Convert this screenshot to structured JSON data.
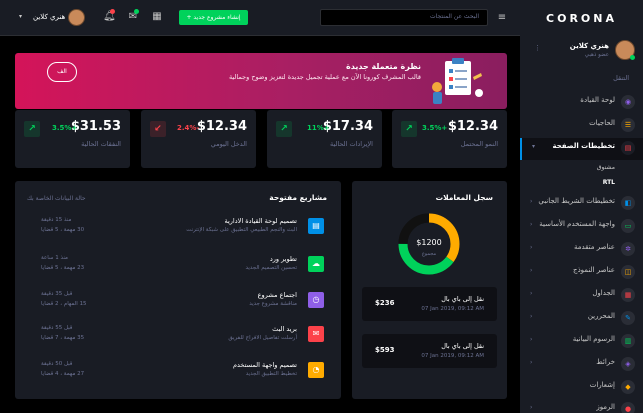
{
  "colors": {
    "bg": "#000000",
    "card": "#191c24",
    "success": "#00d25b",
    "danger": "#fc424a",
    "info": "#0090e7",
    "warning": "#ffab00",
    "primary": "#8f5fe8",
    "muted": "#6c7293"
  },
  "topbar": {
    "user_name": "هنري كلاين",
    "create_button": "+ إنشاء مشروع جديد",
    "search_placeholder": "البحث عن المنتجات",
    "icons": [
      "user-avatar",
      "chevron-down-icon",
      "bell-icon",
      "mail-icon",
      "grid-icon",
      "menu-icon"
    ]
  },
  "sidebar": {
    "brand": "CORONA",
    "profile_name": "هنري كلاين",
    "profile_role": "عضو ذهبي",
    "nav_heading": "التنقل",
    "items": [
      {
        "label": "لوحة القيادة",
        "icon": "speedometer-icon",
        "color": "#8f5fe8"
      },
      {
        "label": "الحاجيات",
        "icon": "playlist-icon",
        "color": "#ffab00"
      },
      {
        "label": "تخطيطات الصفحة",
        "icon": "layout-icon",
        "color": "#fc424a"
      },
      {
        "label": "تخطيطات الشريط الجانبي",
        "icon": "sidebar-icon",
        "color": "#0090e7"
      },
      {
        "label": "واجهة المستخدم الأساسية",
        "icon": "laptop-icon",
        "color": "#00d25b"
      },
      {
        "label": "عناصر متقدمة",
        "icon": "settings-icon",
        "color": "#8f5fe8"
      },
      {
        "label": "عناصر النموذج",
        "icon": "form-icon",
        "color": "#ffab00"
      },
      {
        "label": "الجداول",
        "icon": "table-icon",
        "color": "#fc424a"
      },
      {
        "label": "المحررين",
        "icon": "editor-icon",
        "color": "#0090e7"
      },
      {
        "label": "الرسوم البيانية",
        "icon": "chart-icon",
        "color": "#00d25b"
      },
      {
        "label": "خرائط",
        "icon": "map-icon",
        "color": "#8f5fe8"
      },
      {
        "label": "إشعارات",
        "icon": "bell-icon",
        "color": "#ffab00"
      },
      {
        "label": "الرموز",
        "icon": "contacts-icon",
        "color": "#fc424a"
      }
    ],
    "subitems": [
      "مشنوق",
      "RTL"
    ]
  },
  "banner": {
    "button_label": "الف",
    "title": "نظرة متعملة جديدة",
    "subtitle": "قالب المشرف كورونا الآن مع عملية تجميل جديدة لتعزيز وضوح وجمالية"
  },
  "stats": [
    {
      "value": "$12.34",
      "change": "3.5%+",
      "label": "النمو المحتمل",
      "trend": "up"
    },
    {
      "value": "$17.34",
      "change": "11%+",
      "label": "الإيرادات الحالية",
      "trend": "up"
    },
    {
      "value": "$12.34",
      "change": "2.4%-",
      "label": "الدخل اليومي",
      "trend": "down"
    },
    {
      "value": "$31.53",
      "change": "3.5%+",
      "label": "النفقات الحالية",
      "trend": "up"
    }
  ],
  "projects": {
    "title": "مشاريع مفتوحة",
    "sync_status": "حالة البيانات الخاصة بك",
    "rows": [
      {
        "name": "تصميم لوحة القيادة الادارية",
        "desc": "البث والنجم الطبيعي التطبيق على شبكة الإنترنت",
        "time": "منذ 15 دقيقة",
        "tasks": "30 مهمة ، 5 قضايا",
        "icon": "file-icon",
        "color": "#0090e7"
      },
      {
        "name": "تطوير ورد",
        "desc": "تحسين التصميم الجديد",
        "time": "منذ 1 ساعة",
        "tasks": "23 مهمة ، 5 قضايا",
        "icon": "cloud-download-icon",
        "color": "#00d25b"
      },
      {
        "name": "اجتماع مشروع",
        "desc": "مناقشة مشروع جديد",
        "time": "قبل 35 دقيقة",
        "tasks": "15 المهام ، 2 قضايا",
        "icon": "clock-icon",
        "color": "#8f5fe8"
      },
      {
        "name": "بريد البث",
        "desc": "أرسلت تفاصيل الافراج للفريق",
        "time": "قبل 55 دقيقة",
        "tasks": "35 مهمة ، 7 قضايا",
        "icon": "email-icon",
        "color": "#fc424a"
      },
      {
        "name": "تصميم واجهة المستخدم",
        "desc": "تخطيط التطبيق الجديد",
        "time": "قبل 50 دقيقة",
        "tasks": "27 مهمة ، 4 قضايا",
        "icon": "chart-line-icon",
        "color": "#ffab00"
      }
    ]
  },
  "transactions": {
    "title": "سجل المعاملات",
    "donut_value": "$1200",
    "donut_label": "مجموع",
    "chart_segments": [
      {
        "color": "#ffab00",
        "value": 35
      },
      {
        "color": "#00d25b",
        "value": 40
      },
      {
        "color": "#111111",
        "value": 25
      }
    ],
    "items": [
      {
        "title": "نقل إلى باي بال",
        "date": "07 Jan 2019, 09:12 AM",
        "amount": "$236"
      },
      {
        "title": "نقل إلى باي بال",
        "date": "07 Jan 2019, 09:12 AM",
        "amount": "$593"
      }
    ]
  }
}
